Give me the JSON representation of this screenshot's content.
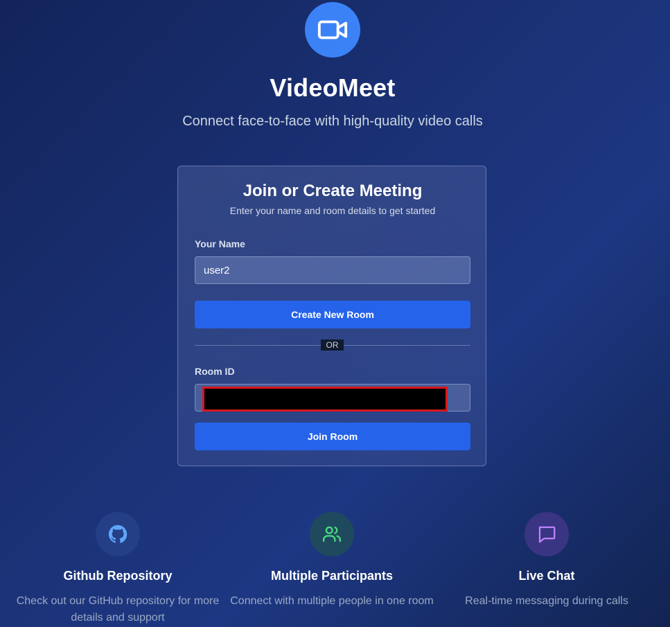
{
  "header": {
    "icon": "video-camera-icon",
    "title": "VideoMeet",
    "subtitle": "Connect face-to-face with high-quality video calls"
  },
  "card": {
    "title": "Join or Create Meeting",
    "subtitle": "Enter your name and room details to get started",
    "name_label": "Your Name",
    "name_value": "user2",
    "create_button": "Create New Room",
    "divider": "OR",
    "room_label": "Room ID",
    "room_value": "",
    "join_button": "Join Room"
  },
  "features": [
    {
      "icon": "github-icon",
      "title": "Github Repository",
      "description": "Check out our GitHub repository for more details and support"
    },
    {
      "icon": "users-icon",
      "title": "Multiple Participants",
      "description": "Connect with multiple people in one room"
    },
    {
      "icon": "chat-bubble-icon",
      "title": "Live Chat",
      "description": "Real-time messaging during calls"
    }
  ],
  "colors": {
    "accent": "#3b82f6",
    "button": "#2563eb",
    "github_icon": "#60a5fa",
    "users_icon": "#4ade80",
    "chat_icon": "#c084fc",
    "redaction_border": "#d9161c"
  }
}
